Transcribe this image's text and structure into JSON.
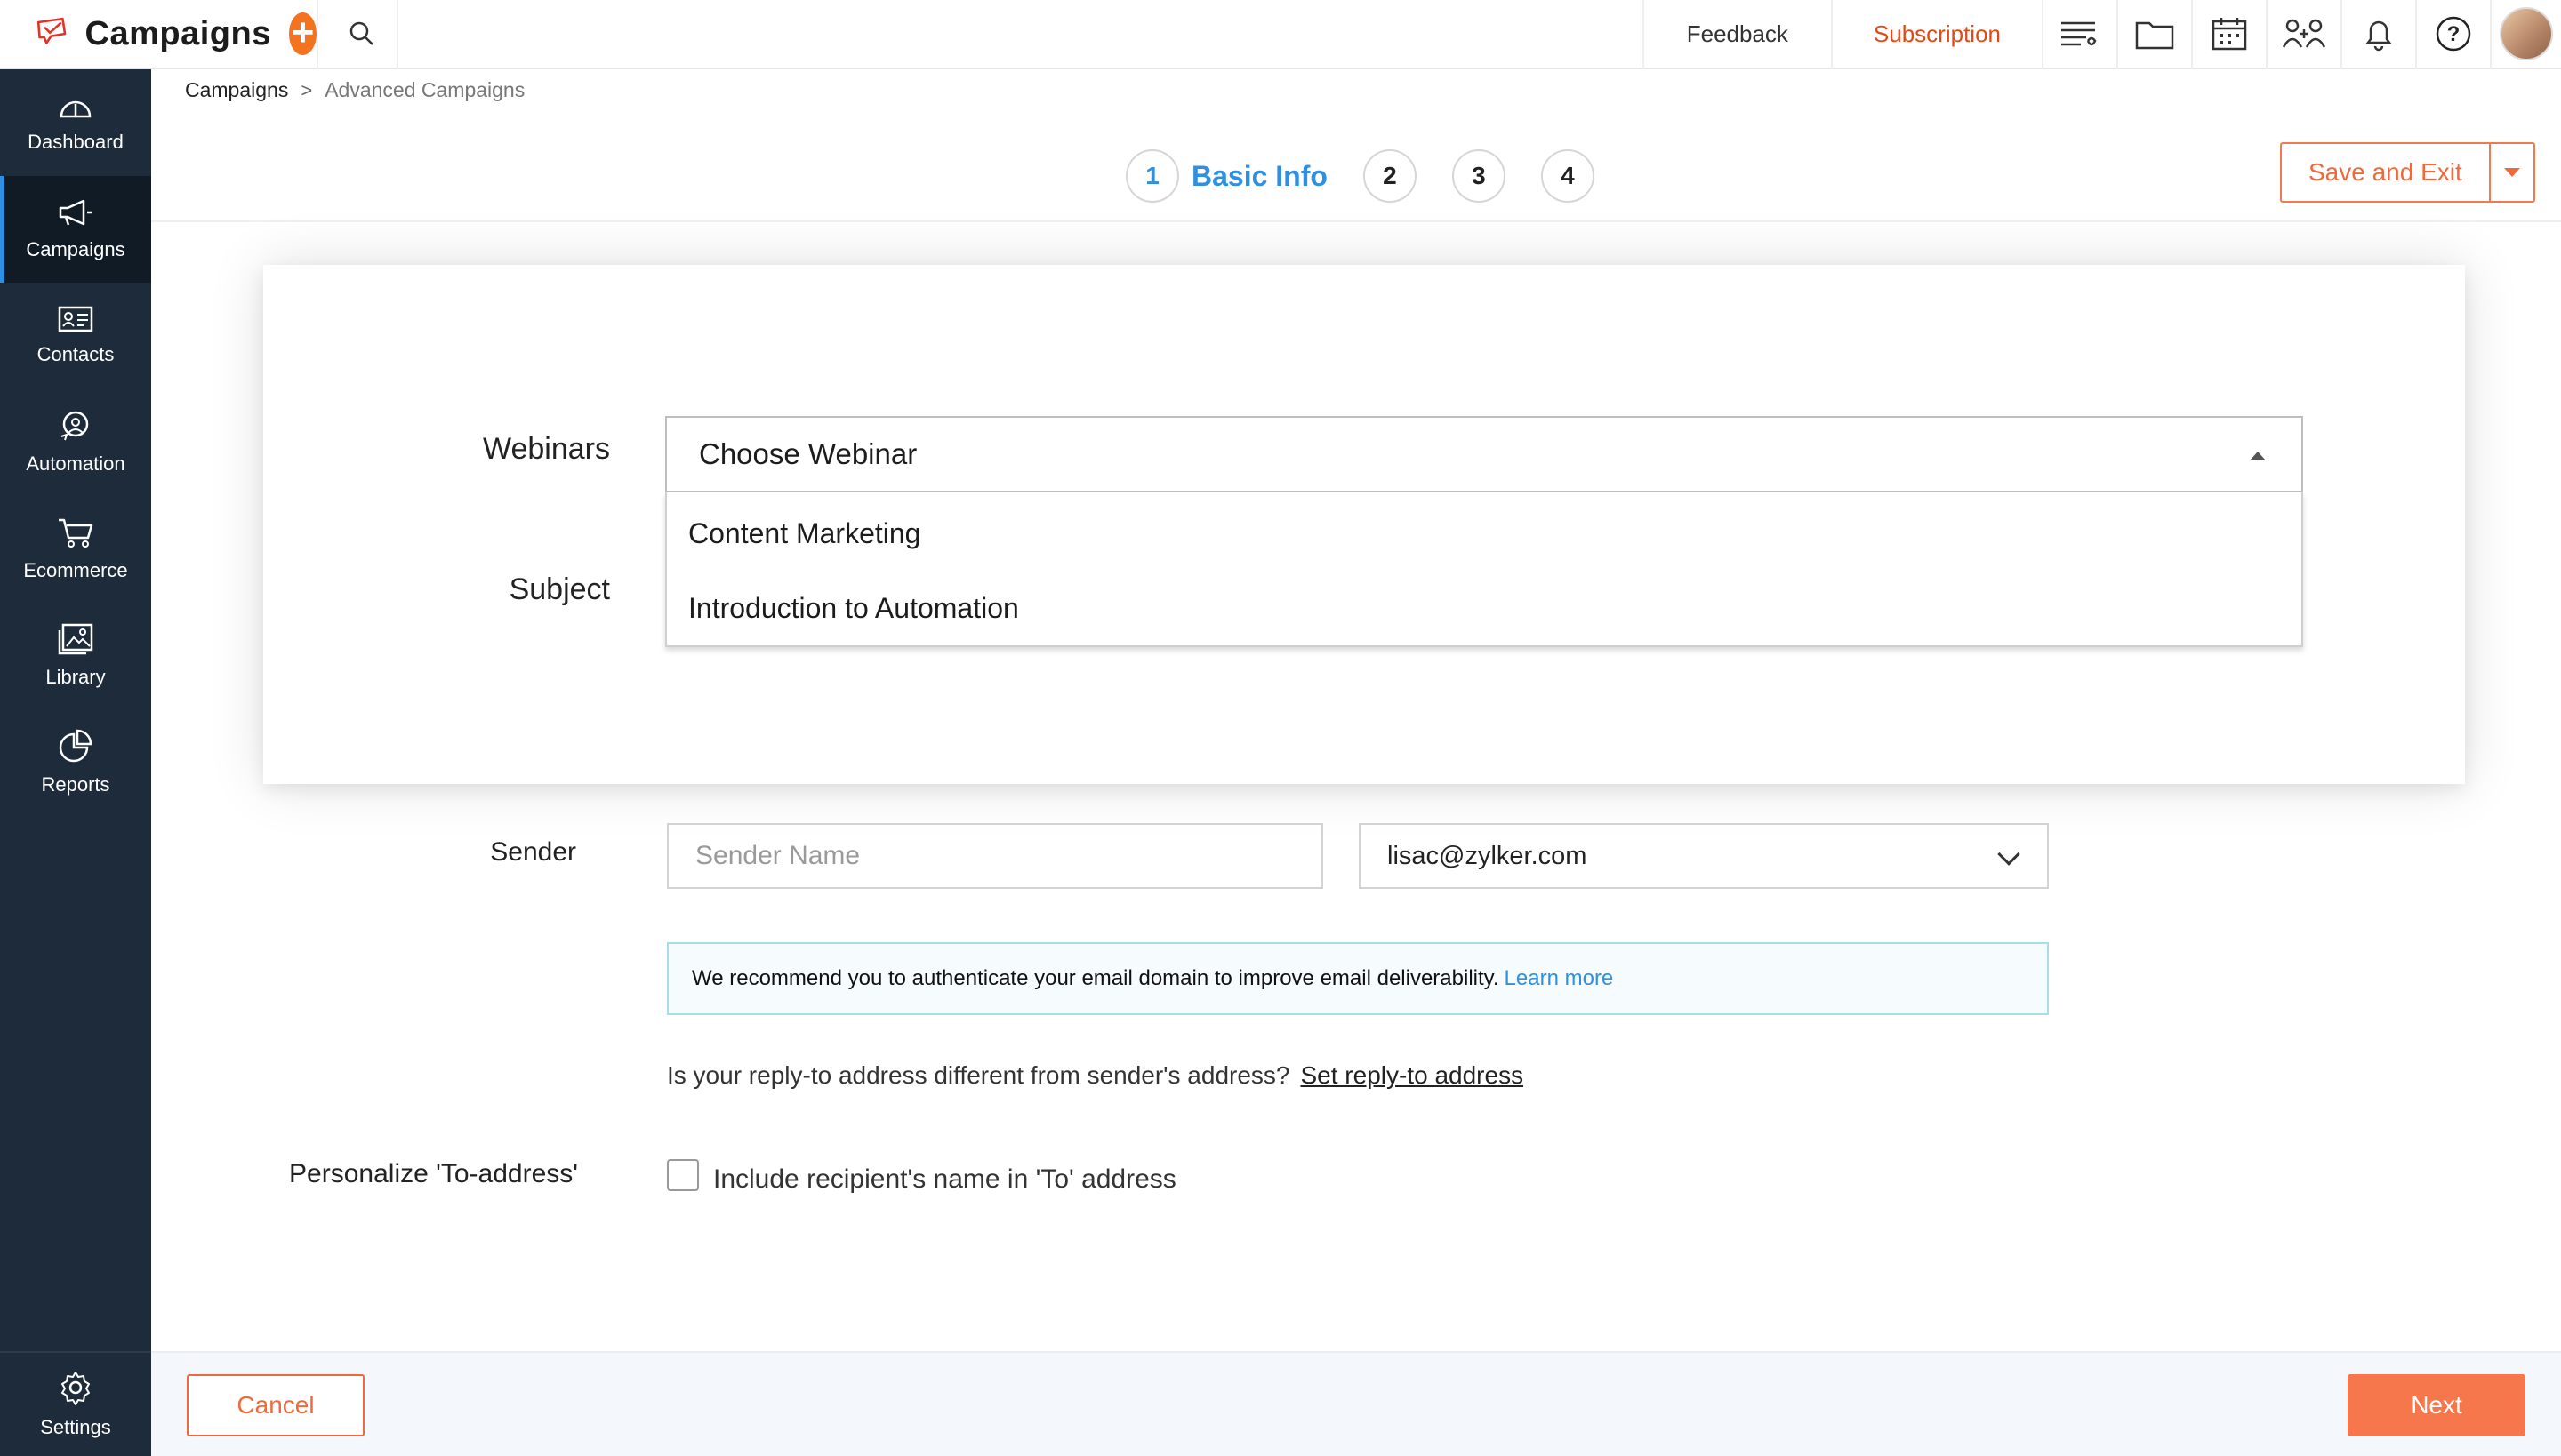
{
  "app": {
    "title": "Campaigns",
    "add_icon": "plus-icon",
    "search_icon": "search-icon"
  },
  "topbar": {
    "feedback_label": "Feedback",
    "subscription_label": "Subscription",
    "icons": [
      "list-icon",
      "folder-icon",
      "calendar-icon",
      "team-icon",
      "bell-icon",
      "help-icon"
    ]
  },
  "sidebar": {
    "items": [
      {
        "label": "Dashboard",
        "icon": "gauge-icon"
      },
      {
        "label": "Campaigns",
        "icon": "megaphone-icon"
      },
      {
        "label": "Contacts",
        "icon": "contact-card-icon"
      },
      {
        "label": "Automation",
        "icon": "automation-icon"
      },
      {
        "label": "Ecommerce",
        "icon": "cart-icon"
      },
      {
        "label": "Library",
        "icon": "image-gallery-icon"
      },
      {
        "label": "Reports",
        "icon": "pie-chart-icon"
      }
    ],
    "settings_label": "Settings",
    "active_item": "Campaigns"
  },
  "breadcrumb": {
    "root": "Campaigns",
    "separator": ">",
    "current": "Advanced Campaigns"
  },
  "stepper": {
    "steps": [
      "1",
      "2",
      "3",
      "4"
    ],
    "active_label": "Basic Info"
  },
  "actions": {
    "save_exit_label": "Save and Exit",
    "cancel_label": "Cancel",
    "next_label": "Next"
  },
  "form": {
    "webinars_label": "Webinars",
    "webinar_placeholder": "Choose Webinar",
    "webinar_options": [
      "Content Marketing",
      "Introduction to Automation"
    ],
    "subject_label": "Subject",
    "sender_label": "Sender",
    "sender_name_placeholder": "Sender Name",
    "sender_email": "lisac@zylker.com",
    "info_text": "We recommend you to authenticate your email domain to improve email deliverability.",
    "info_link": "Learn more",
    "reply_question": "Is your reply-to address different from sender's address?",
    "reply_link": "Set reply-to address",
    "personalize_label": "Personalize 'To-address'",
    "include_name_label": "Include recipient's name in 'To' address",
    "include_name_checked": false
  },
  "colors": {
    "accent_orange": "#f47321",
    "accent_blue": "#2f8fe0",
    "sidebar_bg": "#1e2b3a"
  }
}
